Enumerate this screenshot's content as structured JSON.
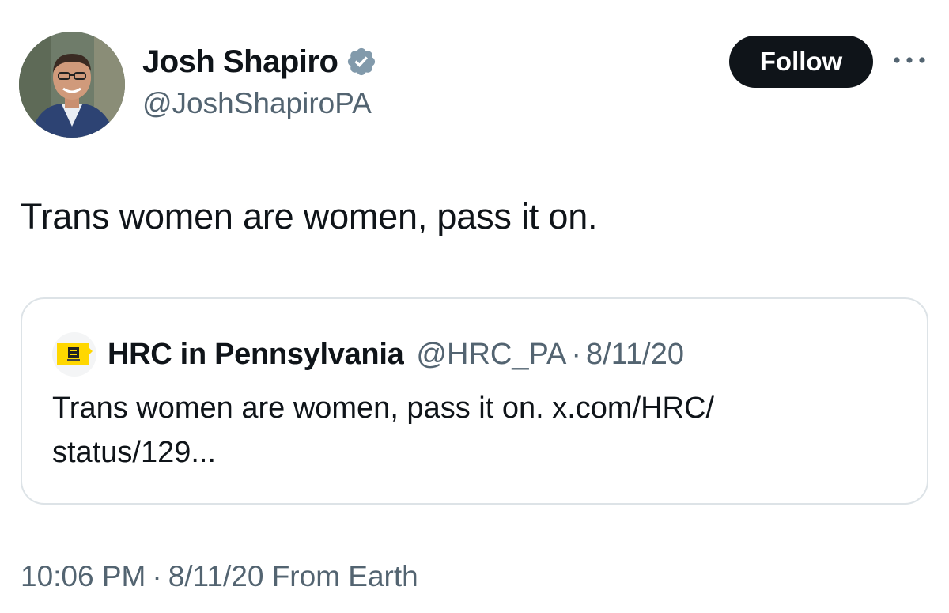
{
  "author": {
    "display_name": "Josh Shapiro",
    "handle": "@JoshShapiroPA",
    "verified": true
  },
  "actions": {
    "follow_label": "Follow",
    "more_icon": "more-horizontal-icon"
  },
  "tweet": {
    "text": "Trans women are women, pass it on.",
    "time": "10:06 PM",
    "separator": "·",
    "date": "8/11/20",
    "source": "From Earth"
  },
  "quote": {
    "display_name": "HRC in Pennsylvania",
    "handle": "@HRC_PA",
    "separator": "·",
    "date": "8/11/20",
    "text_line1": "Trans women are women, pass it on. x.com/HRC/",
    "text_line2": "status/129..."
  },
  "colors": {
    "text_primary": "#0f1419",
    "text_secondary": "#536471",
    "verified_blue": "#1d9bf0",
    "follow_bg": "#0f1419",
    "hrc_yellow": "#ffd700",
    "card_border": "#dde3e7"
  }
}
